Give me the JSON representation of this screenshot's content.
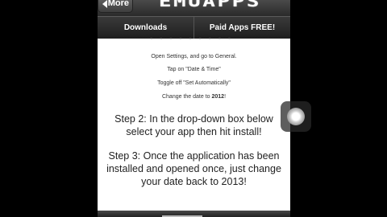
{
  "header": {
    "more_label": "More",
    "logo_text": "EMUAPPS"
  },
  "nav": {
    "tabs": [
      {
        "label": "Downloads"
      },
      {
        "label": "Paid Apps FREE!"
      }
    ]
  },
  "content": {
    "cut_text": "- - - - - - - - -",
    "small_steps": [
      {
        "text": "Open Settings, and go to General."
      },
      {
        "text": "Tap on \"Date & Time\""
      },
      {
        "text": "Toggle off \"Set Automatically\""
      }
    ],
    "change_date_prefix": "Change the date to ",
    "change_date_year": "2012",
    "change_date_suffix": "!",
    "step2": "Step 2: In the drop-down box below select your app then hit install!",
    "step3": "Step 3: Once the application has been installed and opened once, just change your date back to 2013!"
  },
  "colors": {
    "bar_dark": "#2a2a2a",
    "background": "#000000",
    "content_bg": "#ffffff"
  }
}
